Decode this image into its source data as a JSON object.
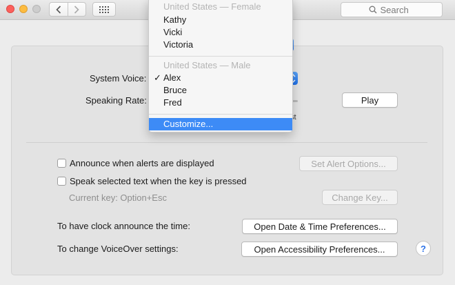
{
  "window": {
    "back_icon": "chevron-left-icon",
    "forward_icon": "chevron-right-icon",
    "grid_icon": "grid-icon",
    "search_placeholder": "Search"
  },
  "voice": {
    "system_voice_label": "System Voice:",
    "speaking_rate_label": "Speaking Rate:",
    "play_label": "Play",
    "slider_tick_fragment": "st"
  },
  "menu": {
    "female_header": "United States — Female",
    "female_voices": [
      "Kathy",
      "Vicki",
      "Victoria"
    ],
    "male_header": "United States — Male",
    "male_voices": [
      "Alex",
      "Bruce",
      "Fred"
    ],
    "checked_voice": "Alex",
    "check_mark": "✓",
    "customize_label": "Customize..."
  },
  "options": {
    "announce_alerts_label": "Announce when alerts are displayed",
    "announce_alerts_checked": false,
    "set_alert_options_label": "Set Alert Options...",
    "speak_selected_label": "Speak selected text when the key is pressed",
    "speak_selected_checked": false,
    "current_key_label": "Current key: Option+Esc",
    "change_key_label": "Change Key...",
    "clock_label": "To have clock announce the time:",
    "clock_button_label": "Open Date & Time Preferences...",
    "voiceover_label": "To change VoiceOver settings:",
    "voiceover_button_label": "Open Accessibility Preferences...",
    "help_label": "?"
  },
  "colors": {
    "accent": "#3d8bf6",
    "close": "#fc605c",
    "minimize": "#fdbc40",
    "zoom_disabled": "#cdcdcd"
  }
}
